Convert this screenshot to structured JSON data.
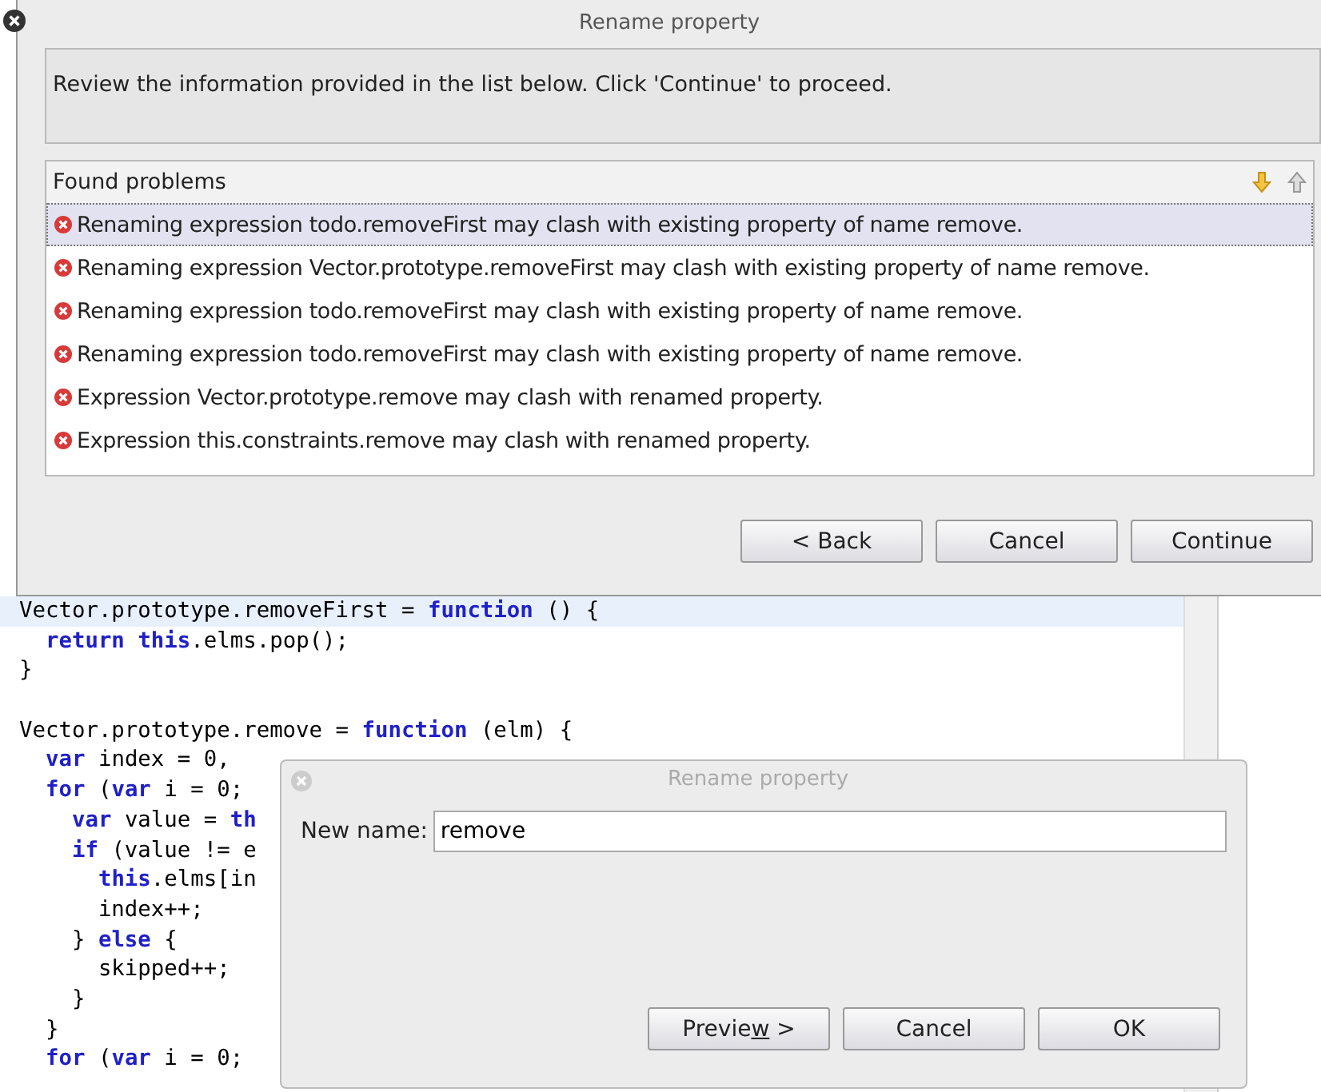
{
  "main_dialog": {
    "title": "Rename property",
    "message": "Review the information provided in the list below. Click 'Continue' to proceed.",
    "problems": {
      "heading": "Found problems",
      "rows": [
        {
          "text": "Renaming expression todo.removeFirst may clash with existing property of name remove.",
          "selected": true
        },
        {
          "text": "Renaming expression Vector.prototype.removeFirst may clash with existing property of name remove.",
          "selected": false
        },
        {
          "text": "Renaming expression todo.removeFirst may clash with existing property of name remove.",
          "selected": false
        },
        {
          "text": "Renaming expression todo.removeFirst may clash with existing property of name remove.",
          "selected": false
        },
        {
          "text": "Expression Vector.prototype.remove may clash with renamed property.",
          "selected": false
        },
        {
          "text": "Expression this.constraints.remove may clash with renamed property.",
          "selected": false
        }
      ]
    },
    "buttons": [
      "< Back",
      "Cancel",
      "Continue"
    ]
  },
  "editor": {
    "lines": [
      {
        "highlighted": true,
        "code": "Vector.prototype.removeFirst = **function** () {"
      },
      {
        "highlighted": false,
        "code": "  **return** **this**.elms.pop();"
      },
      {
        "highlighted": false,
        "code": "}"
      },
      {
        "highlighted": false
      },
      {
        "highlighted": false,
        "code": "Vector.prototype.remove = **function** (elm) {"
      },
      {
        "highlighted": false,
        "code": "  **var** index = 0,"
      },
      {
        "highlighted": false,
        "code": "  **for** (**var** i = 0;"
      },
      {
        "highlighted": false,
        "code": "    **var** value = **th**"
      },
      {
        "highlighted": false,
        "code": "    **if** (value != e"
      },
      {
        "highlighted": false,
        "code": "      **this**.elms[in"
      },
      {
        "highlighted": false,
        "code": "      index++;"
      },
      {
        "highlighted": false,
        "code": "    } **else** {"
      },
      {
        "highlighted": false,
        "code": "      skipped++;"
      },
      {
        "highlighted": false,
        "code": "    }"
      },
      {
        "highlighted": false,
        "code": "  }"
      },
      {
        "highlighted": false,
        "code": "  **for** (**var** i = 0;"
      }
    ]
  },
  "rename_dialog": {
    "title": "Rename property",
    "label": "New name:",
    "value": "remove",
    "buttons": [
      {
        "label_before": "Previe",
        "mnemonic": "w",
        "label_after": " >"
      },
      {
        "label_before": "Cancel"
      },
      {
        "label_before": "OK"
      }
    ]
  }
}
